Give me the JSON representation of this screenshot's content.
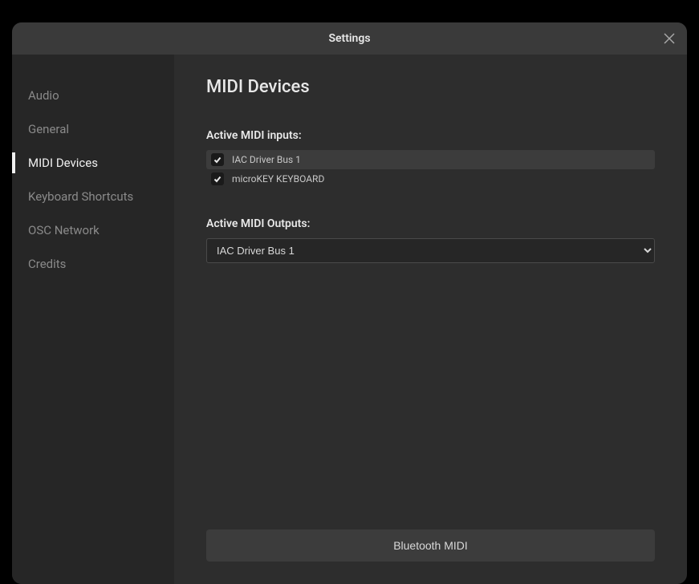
{
  "header": {
    "title": "Settings"
  },
  "sidebar": {
    "items": [
      {
        "label": "Audio",
        "active": false
      },
      {
        "label": "General",
        "active": false
      },
      {
        "label": "MIDI Devices",
        "active": true
      },
      {
        "label": "Keyboard Shortcuts",
        "active": false
      },
      {
        "label": "OSC Network",
        "active": false
      },
      {
        "label": "Credits",
        "active": false
      }
    ]
  },
  "main": {
    "title": "MIDI Devices",
    "inputs_label": "Active MIDI inputs:",
    "inputs": [
      {
        "label": "IAC Driver Bus 1",
        "checked": true,
        "highlight": true
      },
      {
        "label": "microKEY KEYBOARD",
        "checked": true,
        "highlight": false
      }
    ],
    "outputs_label": "Active MIDI Outputs:",
    "output_selected": "IAC Driver Bus 1",
    "bluetooth_label": "Bluetooth MIDI"
  }
}
